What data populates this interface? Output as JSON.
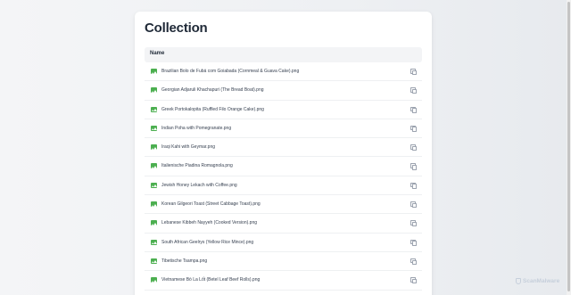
{
  "page": {
    "title": "Collection",
    "column_header": "Name"
  },
  "files": [
    {
      "name": "Brazilian Bolo de Fubá com Goiabada (Cornmeal & Guava Cake).png",
      "icon": "image-icon"
    },
    {
      "name": "Georgian Adjaruli Khachapuri (The Bread Boat).png",
      "icon": "image-icon"
    },
    {
      "name": "Greek Portokalopita (Ruffled Filo Orange Cake).png",
      "icon": "image-icon"
    },
    {
      "name": "Indian Poha with Pomegranate.png",
      "icon": "image-icon"
    },
    {
      "name": "Iraqi Kahi with Geymar.png",
      "icon": "image-icon"
    },
    {
      "name": "Italienische Piadina Romagnola.png",
      "icon": "image-icon"
    },
    {
      "name": "Jewish Honey Lekach with Coffee.png",
      "icon": "image-icon"
    },
    {
      "name": "Korean Gilgeori Toast (Street Cabbage Toast).png",
      "icon": "image-icon"
    },
    {
      "name": "Lebanese Kibbeh Nayyeh (Cooked Version).png",
      "icon": "image-icon"
    },
    {
      "name": "South African Geelrys (Yellow Rice Mince).png",
      "icon": "image-icon"
    },
    {
      "name": "Tibetische Tsampa.png",
      "icon": "image-icon"
    },
    {
      "name": "Vietnamese Bò La Lốt (Betel Leaf Beef Rolls).png",
      "icon": "image-icon"
    }
  ],
  "watermark": {
    "text": "ScanMalware",
    "icon": "shield-icon"
  },
  "colors": {
    "image_icon": "#4caf50",
    "title": "#1f2937",
    "header_bg": "#f3f4f6",
    "copy_icon": "#9ca3af",
    "watermark": "#c6cfdb"
  }
}
